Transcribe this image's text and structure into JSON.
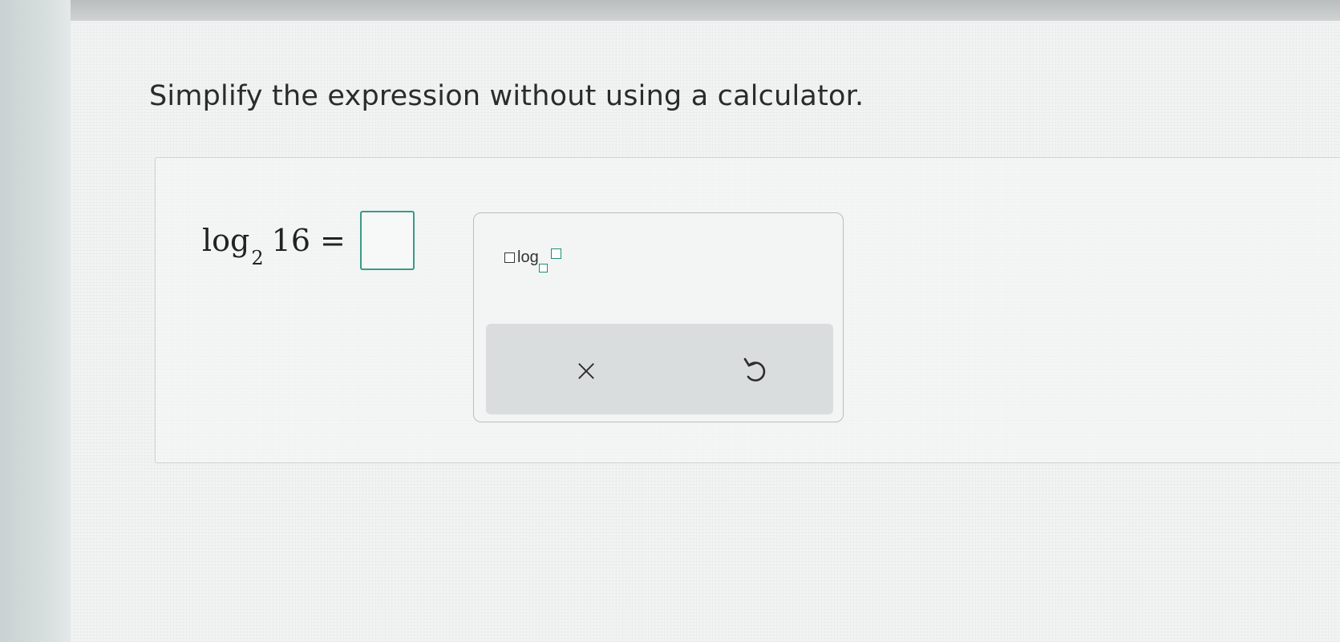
{
  "question": {
    "instruction": "Simplify the expression without using a calculator."
  },
  "equation": {
    "function": "log",
    "base": "2",
    "argument": "16",
    "equals": "="
  },
  "answer": {
    "value": ""
  },
  "palette": {
    "log_template_word": "log",
    "clear_icon": "×",
    "undo_icon": "undo-icon"
  },
  "colors": {
    "accent": "#3a9a86",
    "toolbar_bg": "#d9dddd"
  }
}
